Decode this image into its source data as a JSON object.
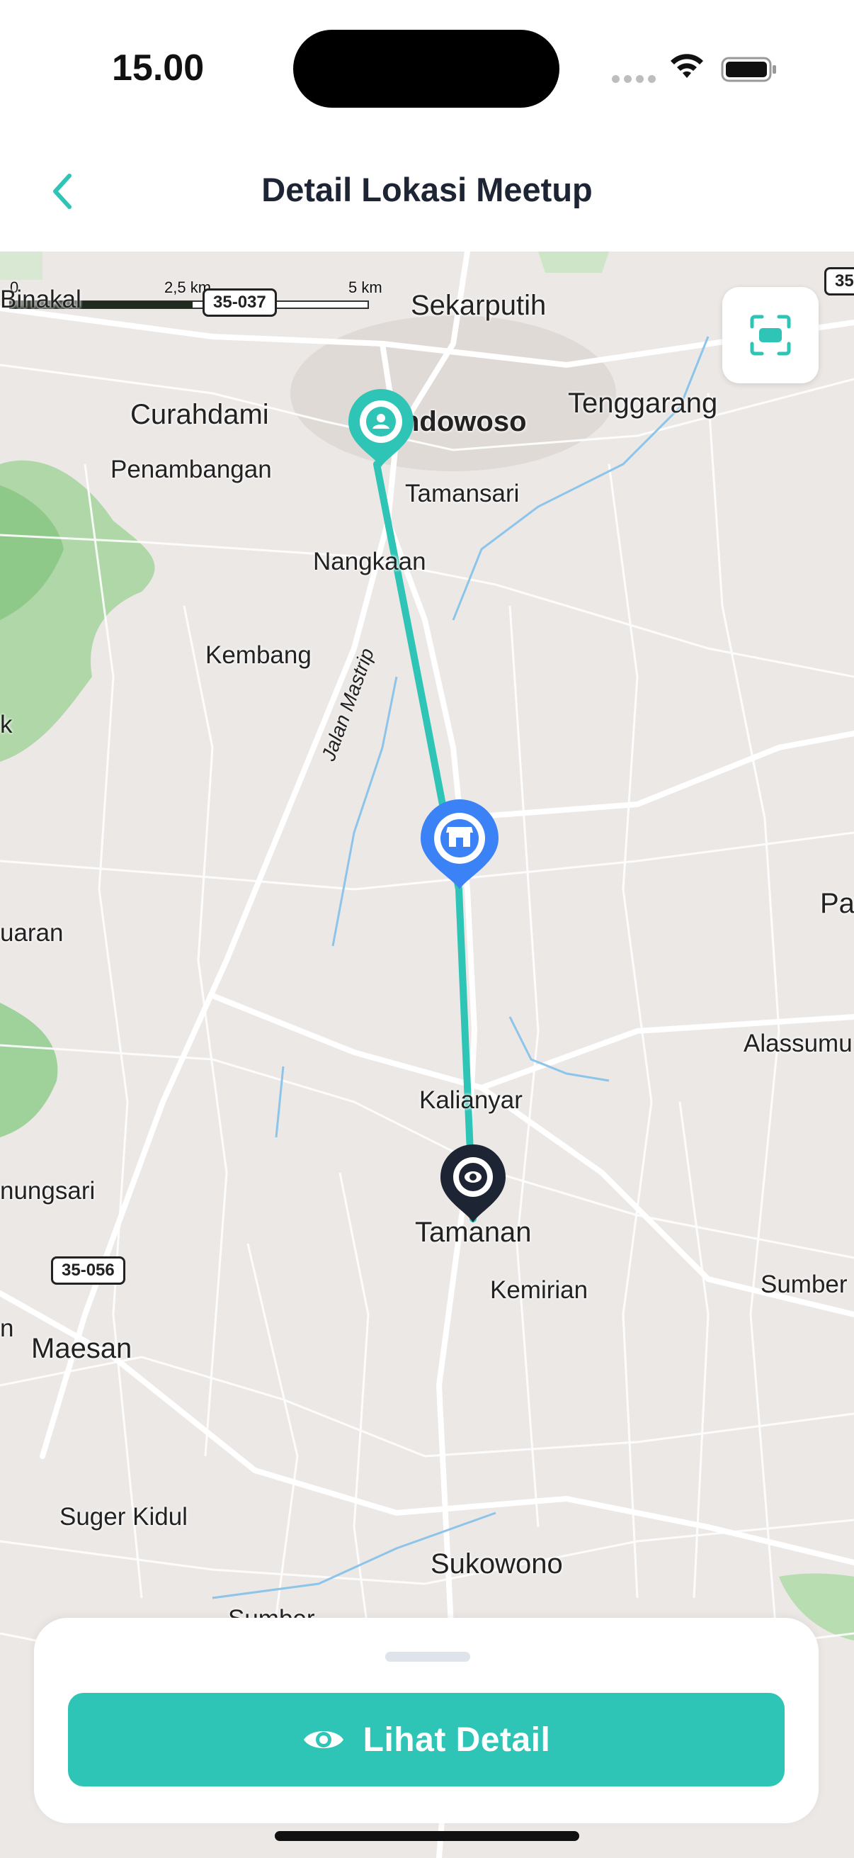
{
  "status_bar": {
    "time": "15.00"
  },
  "header": {
    "title": "Detail Lokasi Meetup",
    "accent_color": "#2ec4b6",
    "back_icon": "chevron-left-icon"
  },
  "map": {
    "scale": {
      "zero": "0",
      "mid": "2,5 km",
      "end": "5 km"
    },
    "places": {
      "sekarputih": "Sekarputih",
      "curahdami": "Curahdami",
      "bondowoso": "ndowoso",
      "tenggarang": "Tenggarang",
      "penambangan": "Penambangan",
      "tamansari": "Tamansari",
      "nangkaan": "Nangkaan",
      "kembang": "Kembang",
      "binakal": "Binakal",
      "luaran": "uaran",
      "alassumur": "Alassumu",
      "pa": "Pa",
      "kalianyar": "Kalianyar",
      "nungsari": "nungsari",
      "tamanan": "Tamanan",
      "kemirian": "Kemirian",
      "sumber_right": "Sumber",
      "maesan": "Maesan",
      "n_left": "n",
      "suger_kidul": "Suger Kidul",
      "sukowono": "Sukowono",
      "sumber_bottom": "Sumber",
      "k_left": "k"
    },
    "road_label": "Jalan Mastrip",
    "shields": {
      "top": "35-037",
      "left": "35-056",
      "right": "35"
    },
    "route_color": "#2ec4b6",
    "pins": {
      "start": "user-location-pin-icon",
      "store": "store-pin-icon",
      "destination": "eye-pin-icon"
    },
    "focus_icon": "focus-frame-icon"
  },
  "bottom_sheet": {
    "button_label": "Lihat Detail",
    "button_icon": "eye-icon"
  }
}
